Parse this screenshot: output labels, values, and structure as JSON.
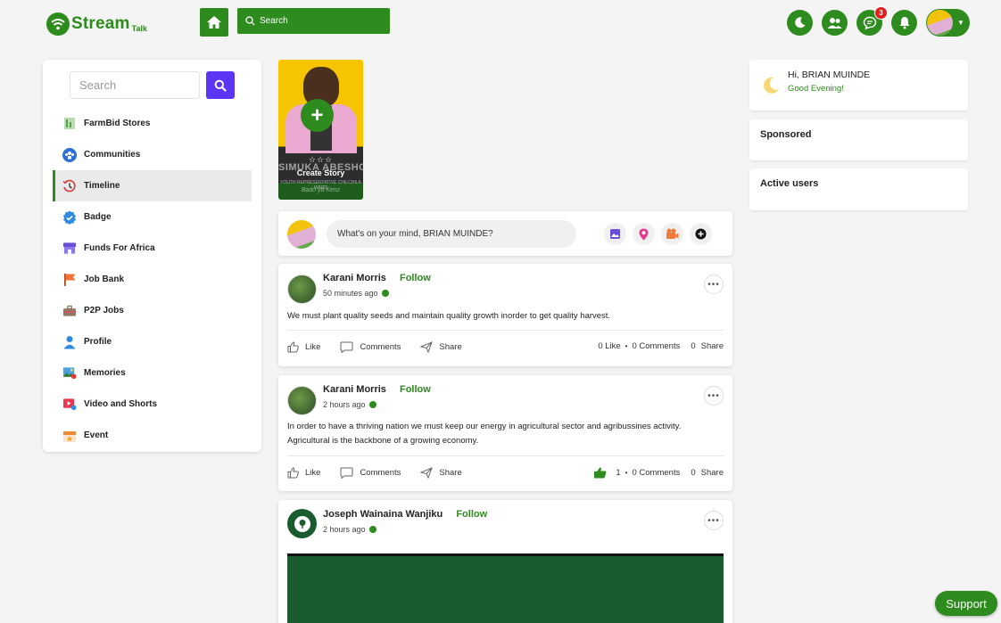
{
  "brand": {
    "name": "Stream",
    "sub": "Talk"
  },
  "topbar": {
    "search_label": "Search",
    "messages_badge": "3"
  },
  "sidebar": {
    "search_placeholder": "Search",
    "items": [
      {
        "label": "FarmBid Stores",
        "icon": "store-icon"
      },
      {
        "label": "Communities",
        "icon": "communities-icon"
      },
      {
        "label": "Timeline",
        "icon": "timeline-icon",
        "active": true
      },
      {
        "label": "Badge",
        "icon": "badge-icon"
      },
      {
        "label": "Funds For Africa",
        "icon": "funds-icon"
      },
      {
        "label": "Job Bank",
        "icon": "flag-icon"
      },
      {
        "label": "P2P Jobs",
        "icon": "briefcase-icon"
      },
      {
        "label": "Profile",
        "icon": "profile-icon"
      },
      {
        "label": "Memories",
        "icon": "memories-icon"
      },
      {
        "label": "Video and Shorts",
        "icon": "video-icon"
      },
      {
        "label": "Event",
        "icon": "event-icon"
      }
    ]
  },
  "story": {
    "label": "Create Story",
    "banner": "SIMUKA ABESHOCHE",
    "stars": "☆☆☆",
    "sub": "YOUTH REPRESENTATIVE CHILCHILA WARD",
    "sig": "Bado ya Kenz"
  },
  "composer": {
    "placeholder": "What's on your mind, BRIAN MUINDE?"
  },
  "posts": [
    {
      "author": "Karani Morris",
      "follow": "Follow",
      "time": "50 minutes ago",
      "text": "We must plant quality seeds and maintain quality growth inorder to get quality harvest.",
      "like_label": "Like",
      "comments_label": "Comments",
      "share_label": "Share",
      "stats": {
        "likes": "0 Like",
        "comments": "0 Comments",
        "shares": "0",
        "share_word": "Share"
      }
    },
    {
      "author": "Karani Morris",
      "follow": "Follow",
      "time": "2 hours ago",
      "text": "In order to have a thriving nation we must keep our energy in agricultural sector and agribussines activity. Agricultural is the backbone of a growing economy.",
      "like_label": "Like",
      "comments_label": "Comments",
      "share_label": "Share",
      "stats": {
        "likes": "1",
        "comments": "0 Comments",
        "shares": "0",
        "share_word": "Share"
      }
    },
    {
      "author": "Joseph Wainaina Wanjiku",
      "follow": "Follow",
      "time": "2 hours ago"
    }
  ],
  "right": {
    "greeting": "Hi, BRIAN MUINDE",
    "time_greeting": "Good Evening!",
    "sponsored": "Sponsored",
    "active_users": "Active users"
  },
  "support": "Support",
  "colors": {
    "brand_green": "#2e8b1e",
    "search_button": "#5b34f4",
    "badge_red": "#e21d1d"
  }
}
